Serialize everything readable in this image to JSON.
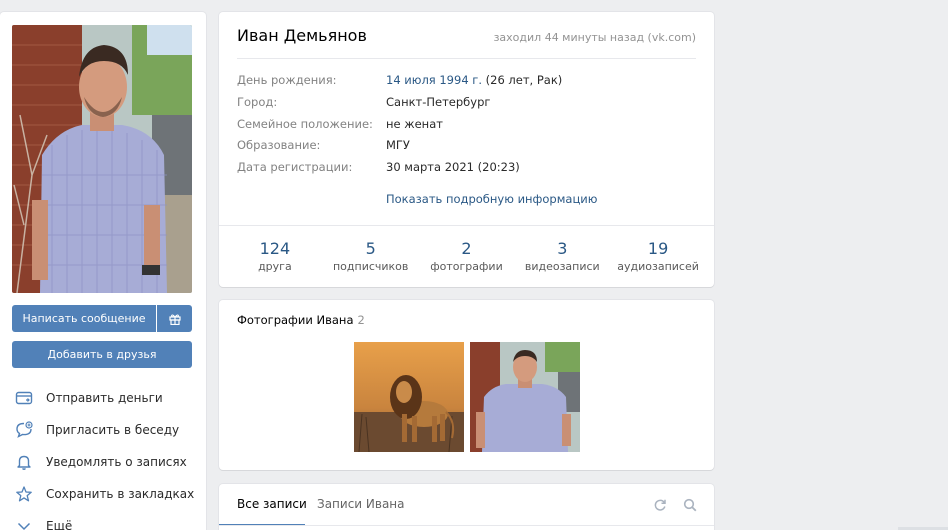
{
  "profile": {
    "name": "Иван Демьянов",
    "last_seen": "заходил 44 минуты назад (vk.com)"
  },
  "actions": {
    "message_label": "Написать сообщение",
    "add_friend_label": "Добавить в друзья"
  },
  "menu": [
    {
      "icon": "money-transfer-icon",
      "label": "Отправить деньги"
    },
    {
      "icon": "invite-chat-icon",
      "label": "Пригласить в беседу"
    },
    {
      "icon": "bell-icon",
      "label": "Уведомлять о записях"
    },
    {
      "icon": "star-icon",
      "label": "Сохранить в закладках"
    },
    {
      "icon": "chevron-down-icon",
      "label": "Ещё"
    }
  ],
  "info": {
    "birthday_label": "День рождения:",
    "birthday_date": "14 июля 1994 г.",
    "birthday_extra": " (26 лет, Рак)",
    "city_label": "Город:",
    "city_value": "Санкт-Петербург",
    "relationship_label": "Семейное положение:",
    "relationship_value": "не женат",
    "education_label": "Образование:",
    "education_value": "МГУ",
    "registration_label": "Дата регистрации:",
    "registration_value": "30 марта 2021 (20:23)",
    "show_more": "Показать подробную информацию"
  },
  "counters": [
    {
      "value": "124",
      "label": "друга"
    },
    {
      "value": "5",
      "label": "подписчиков"
    },
    {
      "value": "2",
      "label": "фотографии"
    },
    {
      "value": "3",
      "label": "видеозаписи"
    },
    {
      "value": "19",
      "label": "аудиозаписей"
    }
  ],
  "photos": {
    "title": "Фотографии Ивана",
    "count": "2"
  },
  "wall": {
    "tab_all": "Все записи",
    "tab_ivan": "Записи Ивана"
  },
  "colors": {
    "accent": "#5181b8",
    "link": "#2a5885",
    "background": "#edeef0"
  }
}
